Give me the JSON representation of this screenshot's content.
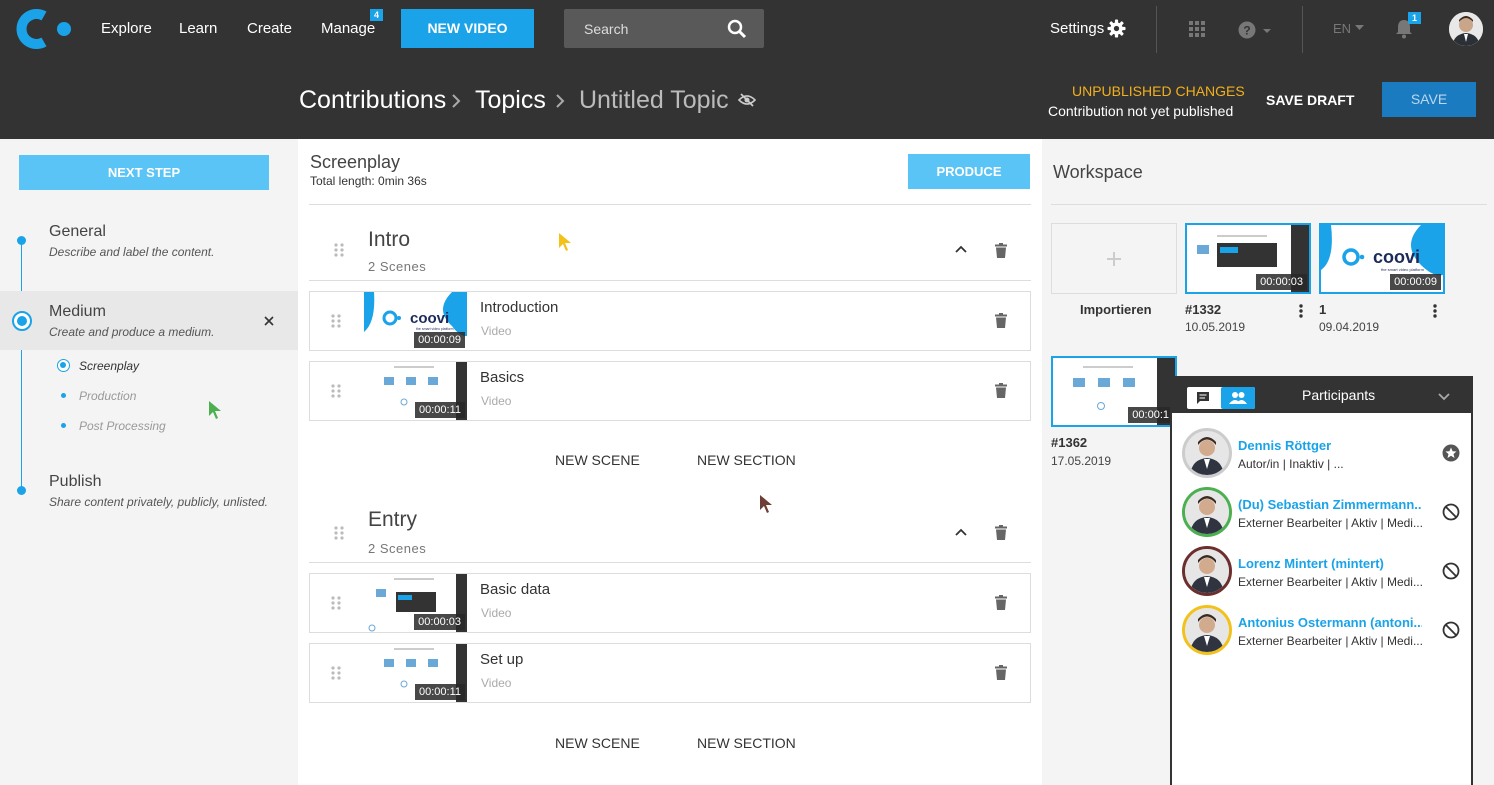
{
  "nav": {
    "links": [
      "Explore",
      "Learn",
      "Create",
      "Manage"
    ],
    "manage_badge": "4",
    "new_video": "NEW VIDEO",
    "search_placeholder": "Search",
    "settings": "Settings",
    "lang": "EN",
    "notif_badge": "1"
  },
  "header": {
    "crumbs": [
      "Contributions",
      "Topics",
      "Untitled Topic"
    ],
    "unpublished": "UNPUBLISHED CHANGES",
    "not_published": "Contribution not yet published",
    "save_draft": "SAVE DRAFT",
    "save": "SAVE"
  },
  "sidebar": {
    "next_step": "NEXT STEP",
    "steps": [
      {
        "title": "General",
        "desc": "Describe and label the content."
      },
      {
        "title": "Medium",
        "desc": "Create and produce a medium."
      },
      {
        "title": "Publish",
        "desc": "Share content privately, publicly, unlisted."
      }
    ],
    "substeps": [
      "Screenplay",
      "Production",
      "Post Processing"
    ]
  },
  "screenplay": {
    "title": "Screenplay",
    "length_label": "Total length: ",
    "length_value": "0min 36s",
    "produce": "PRODUCE",
    "sections": [
      {
        "title": "Intro",
        "count": "2  Scenes",
        "scenes": [
          {
            "name": "Introduction",
            "type": "Video",
            "duration": "00:00:09"
          },
          {
            "name": "Basics",
            "type": "Video",
            "duration": "00:00:11"
          }
        ]
      },
      {
        "title": "Entry",
        "count": "2  Scenes",
        "scenes": [
          {
            "name": "Basic data",
            "type": "Video",
            "duration": "00:00:03"
          },
          {
            "name": "Set up",
            "type": "Video",
            "duration": "00:00:11"
          }
        ]
      }
    ],
    "new_scene": "NEW SCENE",
    "new_section": "NEW SECTION",
    "coovi_word": "coovi",
    "coovi_tag": "the smart video platform"
  },
  "workspace": {
    "title": "Workspace",
    "import": "Importieren",
    "items": [
      {
        "label": "#1332",
        "date": "10.05.2019",
        "duration": "00:00:03"
      },
      {
        "label": "1",
        "date": "09.04.2019",
        "duration": "00:00:09"
      },
      {
        "label": "#1362",
        "date": "17.05.2019",
        "duration": "00:00:1"
      }
    ]
  },
  "participants": {
    "title": "Participants",
    "list": [
      {
        "name": "Dennis Röttger",
        "role": "Autor/in | Inaktiv | ...",
        "ring": "#cccccc"
      },
      {
        "name": "(Du) Sebastian Zimmermann...",
        "role": "Externer Bearbeiter | Aktiv | Medi...",
        "ring": "#4caf50"
      },
      {
        "name": "Lorenz Mintert (mintert)",
        "role": "Externer Bearbeiter | Aktiv | Medi...",
        "ring": "#6d2e2e"
      },
      {
        "name": "Antonius Ostermann (antoni...",
        "role": "Externer Bearbeiter | Aktiv | Medi...",
        "ring": "#f2c21b"
      }
    ]
  },
  "colors": {
    "accent": "#1aa3e8",
    "light_accent": "#5bc4f7",
    "dark": "#333333",
    "warning": "#f2b01e"
  }
}
